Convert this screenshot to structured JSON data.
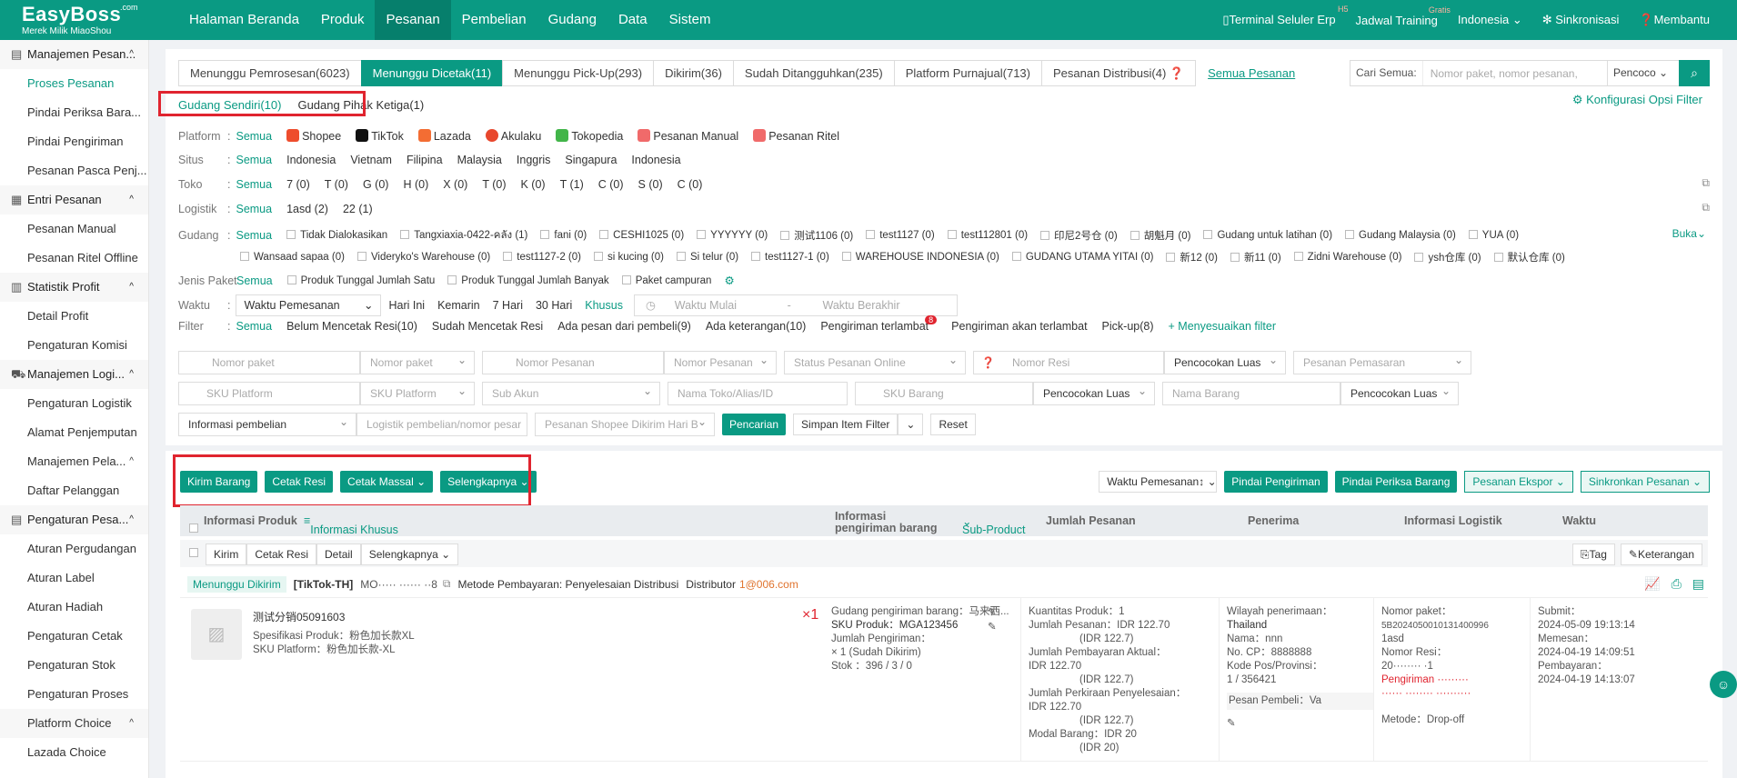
{
  "brand": {
    "name": "EasyBoss",
    "tld": ".com",
    "tagline": "Merek Milik MiaoShou"
  },
  "nav": {
    "items": [
      "Halaman Beranda",
      "Produk",
      "Pesanan",
      "Pembelian",
      "Gudang",
      "Data",
      "Sistem"
    ],
    "active": "Pesanan"
  },
  "topright": {
    "terminal": "Terminal Seluler Erp",
    "terminal_sup": "H5",
    "training": "Jadwal Training",
    "training_sup": "Gratis",
    "language": "Indonesia",
    "sync": "Sinkronisasi",
    "help": "Membantu"
  },
  "sidebar": [
    {
      "group": "Manajemen Pesan...",
      "icon": "orders-icon",
      "items": [
        "Proses Pesanan",
        "Pindai Periksa Bara...",
        "Pindai Pengiriman",
        "Pesanan Pasca Penj..."
      ]
    },
    {
      "group": "Entri Pesanan",
      "icon": "entry-icon",
      "items": [
        "Pesanan Manual",
        "Pesanan Ritel Offline"
      ]
    },
    {
      "group": "Statistik Profit",
      "icon": "stats-icon",
      "items": [
        "Detail Profit",
        "Pengaturan Komisi"
      ]
    },
    {
      "group": "Manajemen Logi...",
      "icon": "truck-icon",
      "items": [
        "Pengaturan Logistik",
        "Alamat Penjemputan"
      ]
    },
    {
      "group2": "Manajemen Pela...",
      "items2": [
        "Daftar Pelanggan"
      ]
    },
    {
      "group": "Pengaturan Pesa...",
      "icon": "settings-icon",
      "items": [
        "Aturan Pergudangan",
        "Aturan Label",
        "Aturan Hadiah",
        "Pengaturan Cetak",
        "Pengaturan Stok",
        "Pengaturan Proses"
      ]
    },
    {
      "group2": "Platform Choice",
      "items2": [
        "Lazada Choice"
      ]
    }
  ],
  "tabs": [
    "Menunggu Pemrosesan(6023)",
    "Menunggu Dicetak(11)",
    "Menunggu Pick-Up(293)",
    "Dikirim(36)",
    "Sudah Ditangguhkan(235)",
    "Platform Purnajual(713)",
    "Pesanan Distribusi(4)"
  ],
  "tab_all": "Semua Pesanan",
  "search": {
    "label": "Cari Semua:",
    "placeholder": "Nomor paket, nomor pesanan,",
    "select": "Pencoco"
  },
  "warehouse_tabs": [
    "Gudang Sendiri(10)",
    "Gudang Pihak Ketiga(1)"
  ],
  "config_filter": "Konfigurasi Opsi Filter",
  "filters": {
    "all": "Semua",
    "platform_label": "Platform",
    "platforms": [
      "Shopee",
      "TikTok",
      "Lazada",
      "Akulaku",
      "Tokopedia",
      "Pesanan Manual",
      "Pesanan Ritel"
    ],
    "site_label": "Situs",
    "sites": [
      "Indonesia",
      "Vietnam",
      "Filipina",
      "Malaysia",
      "Inggris",
      "Singapura",
      "Indonesia"
    ],
    "store_label": "Toko",
    "stores": [
      "7 (0)",
      "T (0)",
      "G (0)",
      "H (0)",
      "X (0)",
      "T (0)",
      "K (0)",
      "T (1)",
      "C (0)",
      "S (0)",
      "C (0)"
    ],
    "logistic_label": "Logistik",
    "logistics": [
      "1asd (2)",
      "22 (1)"
    ],
    "wh_label": "Gudang",
    "warehouses1": [
      "Tidak Dialokasikan",
      "Tangxiaxia-0422-คลัง (1)",
      "fani (0)",
      "CESHI1025 (0)",
      "YYYYYY (0)",
      "测试1106 (0)",
      "test1127 (0)",
      "test112801 (0)",
      "印尼2号仓 (0)",
      "胡魁月 (0)",
      "Gudang untuk latihan (0)",
      "Gudang Malaysia (0)",
      "YUA (0)"
    ],
    "warehouses2": [
      "Wansaad sapaa (0)",
      "Videryko's Warehouse (0)",
      "test1127-2 (0)",
      "si kucing (0)",
      "Si telur (0)",
      "test1127-1 (0)",
      "WAREHOUSE INDONESIA (0)",
      "GUDANG UTAMA YITAI (0)",
      "新12 (0)",
      "新11 (0)",
      "Zidni Warehouse (0)",
      "ysh仓库 (0)",
      "默认仓库 (0)"
    ],
    "wh_more": "Buka",
    "package_label": "Jenis Paket",
    "packages": [
      "Produk Tunggal Jumlah Satu",
      "Produk Tunggal Jumlah Banyak",
      "Paket campuran"
    ],
    "time_label": "Waktu",
    "time_select": "Waktu Pemesanan",
    "times": [
      "Hari Ini",
      "Kemarin",
      "7 Hari",
      "30 Hari",
      "Khusus"
    ],
    "time_start": "Waktu Mulai",
    "time_end": "Waktu Berakhir",
    "filter_label": "Filter",
    "flags": [
      "Belum Mencetak Resi(10)",
      "Sudah Mencetak Resi",
      "Ada pesan dari pembeli(9)",
      "Ada keterangan(10)",
      "Pengiriman terlambat",
      "Pengiriman akan terlambat",
      "Pick-up(8)"
    ],
    "late_badge": "8",
    "custom": "+ Menyesuaikan filter"
  },
  "inputs": {
    "row1": [
      "Nomor paket",
      "Nomor paket",
      "Nomor Pesanan",
      "Nomor Pesanan",
      "Status Pesanan Online",
      "Nomor Resi",
      "Pencocokan Luas",
      "Pesanan Pemasaran"
    ],
    "row2": [
      "SKU Platform",
      "SKU Platform",
      "Sub Akun",
      "Nama Toko/Alias/ID",
      "SKU Barang",
      "Pencocokan Luas",
      "Nama Barang",
      "Pencocokan Luas"
    ],
    "row3": [
      "Informasi pembelian",
      "Logistik pembelian/nomor pesar",
      "Pesanan Shopee Dikirim Hari B"
    ],
    "search_btn": "Pencarian",
    "save_filter": "Simpan Item Filter",
    "reset": "Reset"
  },
  "actions": {
    "left": [
      "Kirim Barang",
      "Cetak Resi",
      "Cetak Massal",
      "Selengkapnya"
    ],
    "sort": "Waktu Pemesanan",
    "right_green": [
      "Pindai Pengiriman",
      "Pindai Periksa Barang"
    ],
    "right_outline": [
      "Pesanan Ekspor",
      "Sinkronkan Pesanan"
    ]
  },
  "table_head": [
    "Informasi Produk",
    "Informasi Khusus",
    "Informasi pengiriman barang",
    "Sub-Product",
    "Jumlah Pesanan",
    "Penerima",
    "Informasi Logistik",
    "Waktu"
  ],
  "sub_actions": [
    "Kirim",
    "Cetak Resi",
    "Detail",
    "Selengkapnya"
  ],
  "tag": "Tag",
  "remark": "Keterangan",
  "order": {
    "status": "Menunggu Dikirim",
    "platform": "[TikTok-TH]",
    "order_no": "MO·····  ······   ··8",
    "payment": "Metode Pembayaran: Penyelesaian Distribusi",
    "distributor_label": "Distributor",
    "distributor": "1@006.com",
    "product_name": "测试分销05091603",
    "spec": "Spesifikasi Produk：粉色加长款XL",
    "platform_sku": "SKU Platform：粉色加长款-XL",
    "qty": "×1",
    "ship_wh": "Gudang pengiriman barang：马来西...",
    "sku": "SKU Produk：MGA123456",
    "ship_qty": "Jumlah Pengiriman：",
    "ship_qty_val": "×  1  (Sudah Dikirim)",
    "stock": "Stok     ：396 / 3 / 0",
    "amount": [
      "Kuantitas Produk：1",
      "Jumlah Pesanan：IDR 122.70",
      "(IDR 122.7)",
      "Jumlah Pembayaran Aktual：",
      "IDR 122.70",
      "(IDR 122.7)",
      "Jumlah Perkiraan Penyelesaian：",
      "IDR 122.70",
      "(IDR 122.7)",
      "Modal Barang：IDR 20",
      "(IDR 20)"
    ],
    "receiver": [
      "Wilayah penerimaan：",
      "Thailand",
      "Nama：nnn",
      "No. CP：8888888",
      "Kode Pos/Provinsi：",
      "1 / 356421"
    ],
    "buyer_msg": "Pesan Pembeli：Va",
    "logistic": [
      "Nomor paket：",
      "5B2024050010131400996",
      "1asd",
      "Nomor Resi：",
      "20········ ·1"
    ],
    "logistic_red": [
      "Pengiriman ·········",
      "······ ········ ··········"
    ],
    "method": "Metode：Drop-off",
    "time": [
      "Submit：",
      "2024-05-09 19:13:14",
      "Memesan：",
      "2024-04-19 14:09:51",
      "Pembayaran：",
      "2024-04-19 14:13:07"
    ]
  },
  "colors": {
    "primary": "#0a9a83",
    "highlight": "#e0242f"
  }
}
